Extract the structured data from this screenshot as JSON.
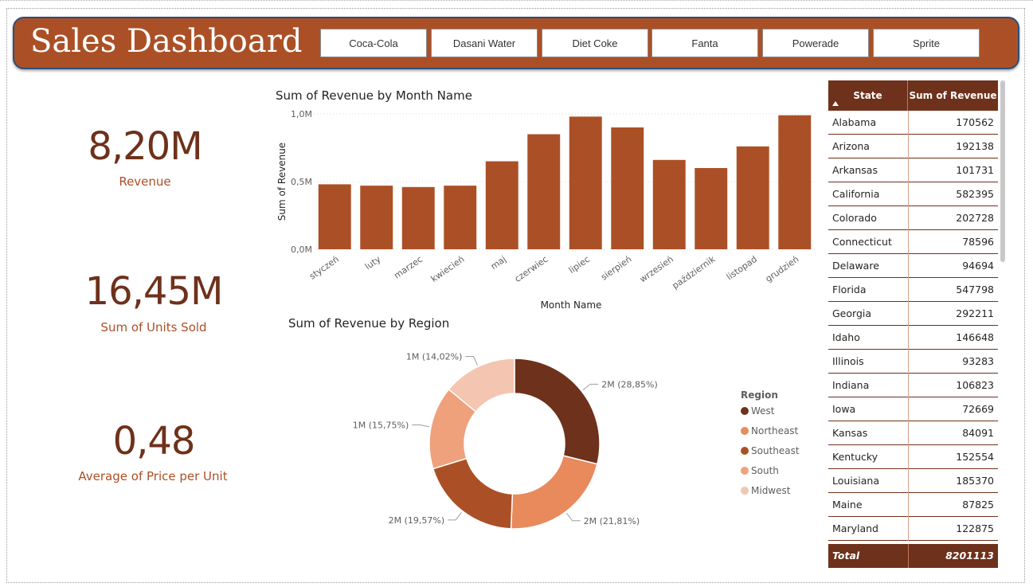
{
  "header": {
    "title": "Sales Dashboard",
    "slicers": [
      "Coca-Cola",
      "Dasani Water",
      "Diet Coke",
      "Fanta",
      "Powerade",
      "Sprite"
    ]
  },
  "kpis": [
    {
      "value": "8,20M",
      "label": "Revenue"
    },
    {
      "value": "16,45M",
      "label": "Sum of Units Sold"
    },
    {
      "value": "0,48",
      "label": "Average of Price per Unit"
    }
  ],
  "colors": {
    "brand": "#ab5026",
    "dark": "#6e311b",
    "west": "#6e311b",
    "northeast": "#e88a5c",
    "southeast": "#ab5026",
    "south": "#efa17c",
    "midwest": "#f4c5b1"
  },
  "chart_data": [
    {
      "type": "bar",
      "title": "Sum of Revenue by Month Name",
      "xlabel": "Month Name",
      "ylabel": "Sum of Revenue",
      "categories": [
        "styczeń",
        "luty",
        "marzec",
        "kwiecień",
        "maj",
        "czerwiec",
        "lipiec",
        "sierpień",
        "wrzesień",
        "październik",
        "listopad",
        "grudzień"
      ],
      "values": [
        0.48,
        0.47,
        0.46,
        0.47,
        0.65,
        0.85,
        0.98,
        0.9,
        0.66,
        0.6,
        0.76,
        0.99
      ],
      "ylim": [
        0,
        1.0
      ],
      "yticks": [
        "0,0M",
        "0,5M",
        "1,0M"
      ],
      "grid": true
    },
    {
      "type": "pie",
      "title": "Sum of Revenue by Region",
      "legend_title": "Region",
      "legend_position": "right",
      "labels": [
        "West",
        "Northeast",
        "Southeast",
        "South",
        "Midwest"
      ],
      "values": [
        28.85,
        21.81,
        19.57,
        15.75,
        14.02
      ],
      "data_labels": [
        "2M (28,85%)",
        "2M (21,81%)",
        "2M (19,57%)",
        "1M (15,75%)",
        "1M (14,02%)"
      ]
    }
  ],
  "table": {
    "headers": [
      "State",
      "Sum of Revenue"
    ],
    "rows": [
      [
        "Alabama",
        "170562"
      ],
      [
        "Arizona",
        "192138"
      ],
      [
        "Arkansas",
        "101731"
      ],
      [
        "California",
        "582395"
      ],
      [
        "Colorado",
        "202728"
      ],
      [
        "Connecticut",
        "78596"
      ],
      [
        "Delaware",
        "94694"
      ],
      [
        "Florida",
        "547798"
      ],
      [
        "Georgia",
        "292211"
      ],
      [
        "Idaho",
        "146648"
      ],
      [
        "Illinois",
        "93283"
      ],
      [
        "Indiana",
        "106823"
      ],
      [
        "Iowa",
        "72669"
      ],
      [
        "Kansas",
        "84091"
      ],
      [
        "Kentucky",
        "152554"
      ],
      [
        "Louisiana",
        "185370"
      ],
      [
        "Maine",
        "87825"
      ],
      [
        "Maryland",
        "122875"
      ]
    ],
    "total_label": "Total",
    "total_value": "8201113"
  }
}
